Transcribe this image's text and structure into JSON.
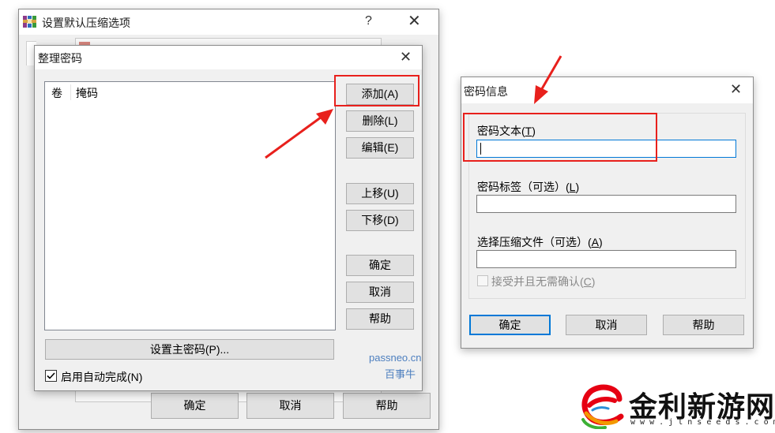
{
  "main_window": {
    "title": "设置默认压缩选项",
    "help_glyph": "?",
    "close_glyph": "✕",
    "buttons": {
      "ok": "确定",
      "cancel": "取消",
      "help": "帮助"
    }
  },
  "organize_dialog": {
    "title": "整理密码",
    "close_glyph": "✕",
    "columns": [
      "卷",
      "掩码"
    ],
    "buttons": {
      "add": "添加(A)",
      "delete": "删除(L)",
      "edit": "编辑(E)",
      "move_up": "上移(U)",
      "move_down": "下移(D)",
      "ok": "确定",
      "cancel": "取消",
      "help": "帮助"
    },
    "set_master_password": "设置主密码(P)...",
    "autocomplete": {
      "label": "启用自动完成(N)",
      "checked": true
    },
    "watermark": {
      "line1": "passneo.cn",
      "line2": "百事牛"
    }
  },
  "password_info_dialog": {
    "title": "密码信息",
    "close_glyph": "✕",
    "password_text": {
      "label_prefix": "密码文本(",
      "key": "T",
      "label_suffix": ")",
      "value": ""
    },
    "password_tag": {
      "label_prefix": "密码标签（可选）(",
      "key": "L",
      "label_suffix": ")",
      "value": ""
    },
    "select_archive": {
      "label_prefix": "选择压缩文件（可选）(",
      "key": "A",
      "label_suffix": ")",
      "value": ""
    },
    "accept_checkbox": {
      "label_prefix": "接受并且无需确认(",
      "key": "C",
      "label_suffix": ")",
      "checked": false
    },
    "buttons": {
      "ok": "确定",
      "cancel": "取消",
      "help": "帮助"
    }
  },
  "brand": {
    "name": "金利新游网",
    "url": "w w w . j l n s e e d s . c o m",
    "colors": {
      "red": "#e60012",
      "orange": "#f39800",
      "green": "#3cb035",
      "blue": "#2a8fd8"
    }
  },
  "annotation_color": "#e8201c"
}
